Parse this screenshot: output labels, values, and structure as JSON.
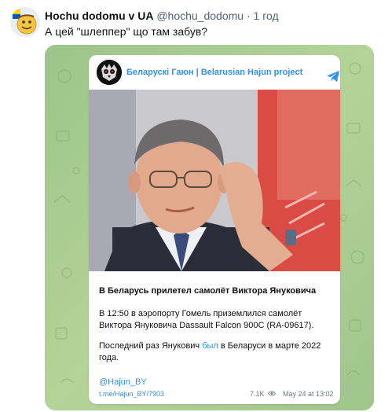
{
  "tweet": {
    "author_name": "Hochu dodomu v UA",
    "author_handle": "@hochu_dodomu",
    "separator": "·",
    "time": "1 год",
    "text": "А цей \"шлеппер\" що там забув?"
  },
  "post": {
    "channel_name": "Беларускі Гаюн | Belarusian Hajun project",
    "title": "В Беларусь прилетел самолёт Виктора Януковича",
    "paragraph1": "В 12:50 в аэропорту Гомель приземлился самолёт Виктора Януковича Dassault Falcon 900C (RA-09617).",
    "paragraph2_before": "Последний раз Янукович ",
    "paragraph2_link": "был",
    "paragraph2_after": " в Беларуси в марте 2022 года.",
    "mention": "@Hajun_BY",
    "url": "t.me/Hajun_BY/7903",
    "views": "7.1K",
    "date": "May 24 at 13:02"
  },
  "icons": {
    "avatar": "smiling-emoji-avatar",
    "channel_logo": "hajun-owl-logo",
    "telegram": "telegram-plane-icon",
    "views": "eye-icon"
  },
  "colors": {
    "link_blue": "#3390ec",
    "background_green": "#a9c98f",
    "muted_gray": "#536471"
  }
}
